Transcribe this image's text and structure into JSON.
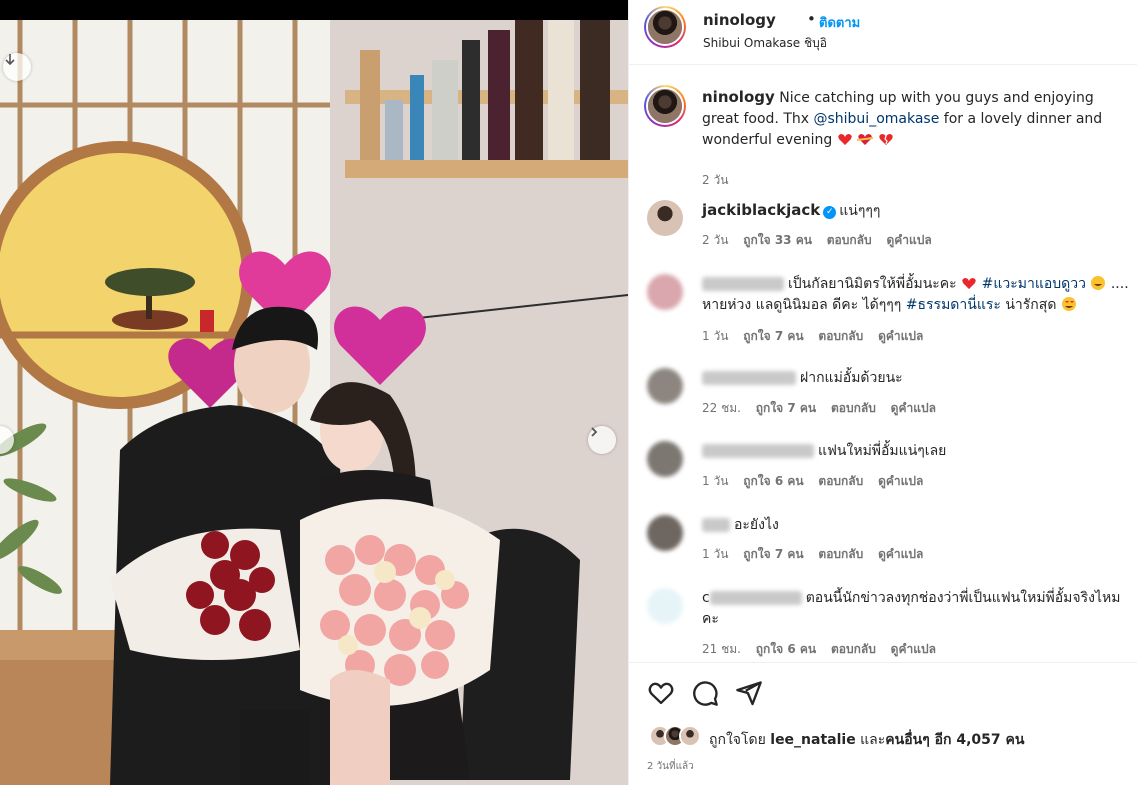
{
  "header": {
    "username": "ninology",
    "dot": "•",
    "follow_label": "ติดตาม",
    "location": "Shibui Omakase ชิบุอิ"
  },
  "caption": {
    "username": "ninology",
    "text_before": " Nice catching up with you guys and enjoying great food. Thx ",
    "mention": "@shibui_omakase",
    "text_after": " for a lovely dinner and wonderful evening ",
    "time": "2 วัน"
  },
  "comments": [
    {
      "username": "jackiblackjack",
      "verified": true,
      "text": "แน่ๆๆๆ",
      "time": "2 วัน",
      "likes": "ถูกใจ 33 คน",
      "reply": "ตอบกลับ",
      "translate": "ดูคำแปล"
    },
    {
      "text_1": "เป็นกัลยานิมิตรให้พี่อั้มนะคะ ",
      "hashtag_1": "#แวะมาแอบดูวว",
      "text_2": " .... หายห่วง แลดูนินิมอล ดีคะ ได้ๆๆๆ ",
      "hashtag_2": "#ธรรมดานี่แระ",
      "text_3": " น่ารักสุด ",
      "time": "1 วัน",
      "likes": "ถูกใจ 7 คน",
      "reply": "ตอบกลับ",
      "translate": "ดูคำแปล"
    },
    {
      "text": "ฝากแม่อั้มด้วยนะ",
      "time": "22 ชม.",
      "likes": "ถูกใจ 7 คน",
      "reply": "ตอบกลับ",
      "translate": "ดูคำแปล"
    },
    {
      "text": "แฟนใหม่พี่อั้มแน่ๆเลย",
      "time": "1 วัน",
      "likes": "ถูกใจ 6 คน",
      "reply": "ตอบกลับ",
      "translate": "ดูคำแปล"
    },
    {
      "text": "อะยังไง",
      "time": "1 วัน",
      "likes": "ถูกใจ 7 คน",
      "reply": "ตอบกลับ",
      "translate": "ดูคำแปล"
    },
    {
      "name_start": "c",
      "text": "ตอนนี้นักข่าวลงทุกช่องว่าพี่เป็นแฟนใหม่พี่อั้มจริงไหมคะ",
      "time": "21 ชม.",
      "likes": "ถูกใจ 6 คน",
      "reply": "ตอบกลับ",
      "translate": "ดูคำแปล"
    }
  ],
  "likes": {
    "prefix": "ถูกใจโดย ",
    "first_liker": "lee_natalie",
    "middle": " และ",
    "others": "คนอื่นๆ อีก 4,057 คน"
  },
  "post_time": "2 วันที่แล้ว",
  "icons": {
    "like": "heart-icon",
    "comment": "comment-bubble-icon",
    "share": "paper-plane-icon",
    "audio": "arrow-down-circle-icon",
    "next": "chevron-right-icon"
  },
  "colors": {
    "link_blue": "#0095f6",
    "hashtag": "#00376b",
    "secondary_text": "#737373",
    "emoji_red": "#e8282b"
  }
}
